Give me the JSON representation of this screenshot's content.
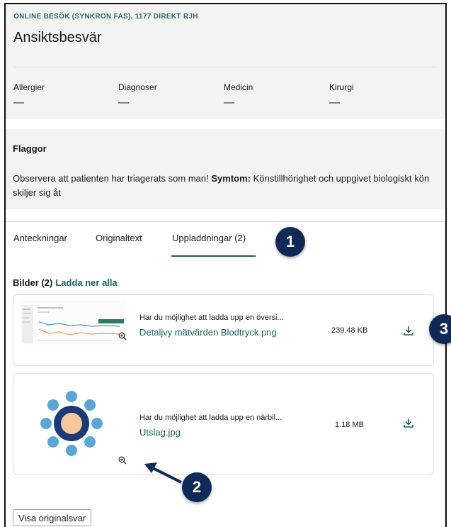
{
  "header": {
    "visit_type": "ONLINE BESÖK (SYNKRON FAS), 1177 DIREKT RJH",
    "title": "Ansiktsbesvär",
    "summary": [
      {
        "label": "Allergier",
        "value": "—"
      },
      {
        "label": "Diagnoser",
        "value": "—"
      },
      {
        "label": "Medicin",
        "value": "—"
      },
      {
        "label": "Kirurgi",
        "value": "—"
      }
    ]
  },
  "flags": {
    "title": "Flaggor",
    "text_pre": "Observera att patienten har triagerats som man! ",
    "text_bold": "Symtom:",
    "text_post": " Könstillhörighet och uppgivet biologiskt kön skiljer sig åt"
  },
  "tabs": [
    {
      "label": "Anteckningar"
    },
    {
      "label": "Originaltext"
    },
    {
      "label": "Uppladdningar (2)",
      "active": true
    }
  ],
  "badges": {
    "b1": "1",
    "b2": "2",
    "b3": "3"
  },
  "images": {
    "heading": "Bilder (2)",
    "download_all": "Ladda ner alla",
    "items": [
      {
        "message": "Har du möjlighet att ladda upp en översi...",
        "filename": "Detaljvy mätvärden Blodtryck.png",
        "size": "239.48 KB"
      },
      {
        "message": "Har du möjlighet att ladda upp en närbil...",
        "filename": "Utslag.jpg",
        "size": "1.18 MB"
      }
    ]
  },
  "footer": {
    "original_button": "Visa originalsvar"
  },
  "colors": {
    "accent": "#1b6060",
    "badge": "#0f2a57",
    "panel": "#f3f3f3",
    "thumb_ring": "#5aa6d6",
    "thumb_center": "#f7c99a",
    "thumb_core": "#1a3b7a"
  }
}
